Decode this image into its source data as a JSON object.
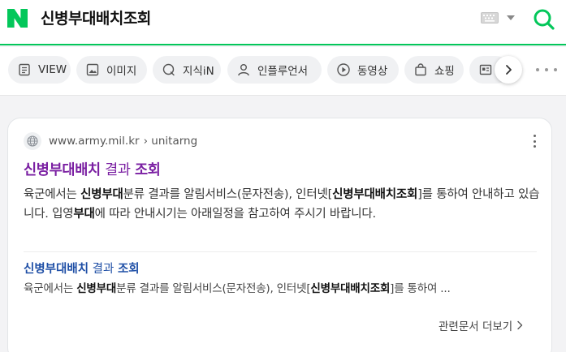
{
  "header": {
    "query": "신병부대배치조회",
    "logo_color": "#03c75a"
  },
  "tabs": [
    {
      "label": "VIEW",
      "icon": "document-icon"
    },
    {
      "label": "이미지",
      "icon": "image-icon"
    },
    {
      "label": "지식iN",
      "icon": "qna-icon"
    },
    {
      "label": "인플루언서",
      "icon": "person-icon"
    },
    {
      "label": "동영상",
      "icon": "play-icon"
    },
    {
      "label": "쇼핑",
      "icon": "shopping-bag-icon"
    },
    {
      "label": "",
      "icon": "news-icon"
    }
  ],
  "result": {
    "site_url": "www.army.mil.kr",
    "site_path": "› unitarng",
    "title_parts": [
      "신병부대배치",
      " 결과 ",
      "조회"
    ],
    "desc_parts": [
      "육군에서는 ",
      "신병부대",
      "분류 결과를 알림서비스(문자전송), 인터넷[",
      "신병부대배치조회",
      "]를 통하여 안내하고 있습니다. 입영",
      "부대",
      "에 따라 안내시기는 아래일정을 참고하여 주시기 바랍니다."
    ],
    "sub_title_parts": [
      "신병부대배치",
      " 결과 ",
      "조회"
    ],
    "sub_desc_parts": [
      "육군에서는 ",
      "신병부대",
      "분류 결과를 알림서비스(문자전송), 인터넷[",
      "신병부대배치조회",
      "]를 통하여 ..."
    ],
    "related_label": "관련문서 더보기"
  }
}
